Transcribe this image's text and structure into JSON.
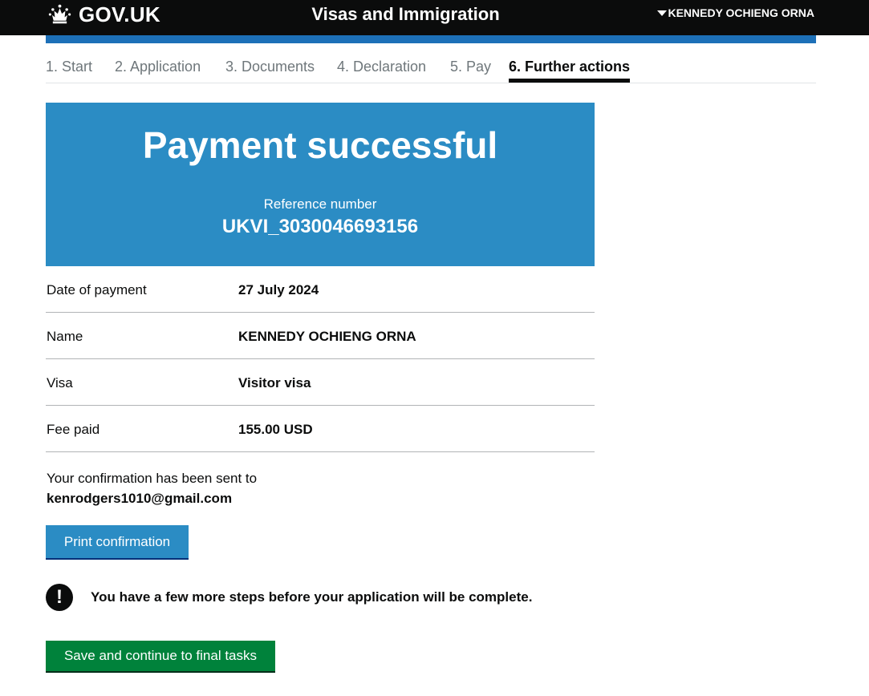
{
  "header": {
    "logo_text": "GOV.UK",
    "service_name": "Visas and Immigration",
    "user_name": "KENNEDY OCHIENG ORNA"
  },
  "steps": [
    {
      "label": "1. Start",
      "active": false
    },
    {
      "label": "2. Application",
      "active": false
    },
    {
      "label": "3. Documents",
      "active": false
    },
    {
      "label": "4. Declaration",
      "active": false
    },
    {
      "label": "5. Pay",
      "active": false
    },
    {
      "label": "6. Further actions",
      "active": true
    }
  ],
  "panel": {
    "title": "Payment successful",
    "reference_label": "Reference number",
    "reference_number": "UKVI_3030046693156"
  },
  "summary": [
    {
      "key": "Date of payment",
      "value": "27 July 2024"
    },
    {
      "key": "Name",
      "value": "KENNEDY OCHIENG ORNA"
    },
    {
      "key": "Visa",
      "value": "Visitor visa"
    },
    {
      "key": "Fee paid",
      "value": "155.00 USD"
    }
  ],
  "confirmation": {
    "text": "Your confirmation has been sent to",
    "email": "kenrodgers1010@gmail.com"
  },
  "buttons": {
    "print_label": "Print confirmation",
    "continue_label": "Save and continue to final tasks"
  },
  "warning": {
    "icon": "!",
    "text": "You have a few more steps before your application will be complete."
  },
  "colors": {
    "header_bg": "#0b0c0c",
    "brand_blue": "#1d70b8",
    "panel_blue": "#2b8cc4",
    "button_green": "#00823b"
  },
  "icons": {
    "logo": "crown-icon",
    "user_menu": "caret-down-icon",
    "warning": "exclamation-icon"
  }
}
